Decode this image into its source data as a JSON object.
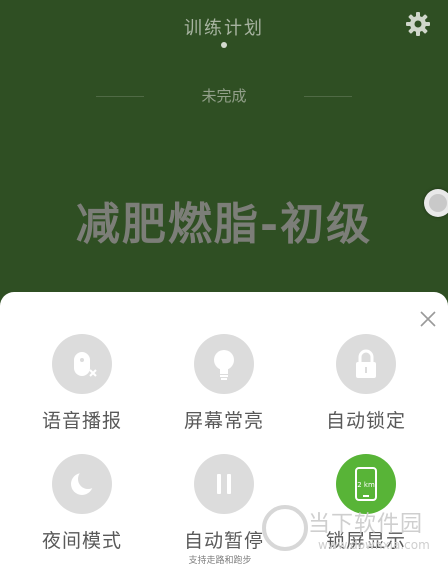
{
  "header": {
    "title": "训练计划",
    "status": "未完成"
  },
  "plan": {
    "name": "减肥燃脂-初级"
  },
  "panel": {
    "options": [
      {
        "label": "语音播报",
        "icon": "voice-mute-icon",
        "active": false
      },
      {
        "label": "屏幕常亮",
        "icon": "lightbulb-icon",
        "active": false
      },
      {
        "label": "自动锁定",
        "icon": "lock-icon",
        "active": false
      },
      {
        "label": "夜间模式",
        "icon": "moon-icon",
        "active": false
      },
      {
        "label": "自动暂停",
        "icon": "pause-icon",
        "active": false
      },
      {
        "label": "锁屏显示",
        "icon": "phone-km-icon",
        "active": true,
        "icon_text": "2 km"
      }
    ],
    "pause_subtitle": "支持走路和跑步"
  },
  "watermark": {
    "title": "当下软件园",
    "url": "www.downxia.com"
  },
  "colors": {
    "background": "#2f4f23",
    "accent": "#58b437",
    "inactive_circle": "#dcdcdc"
  }
}
